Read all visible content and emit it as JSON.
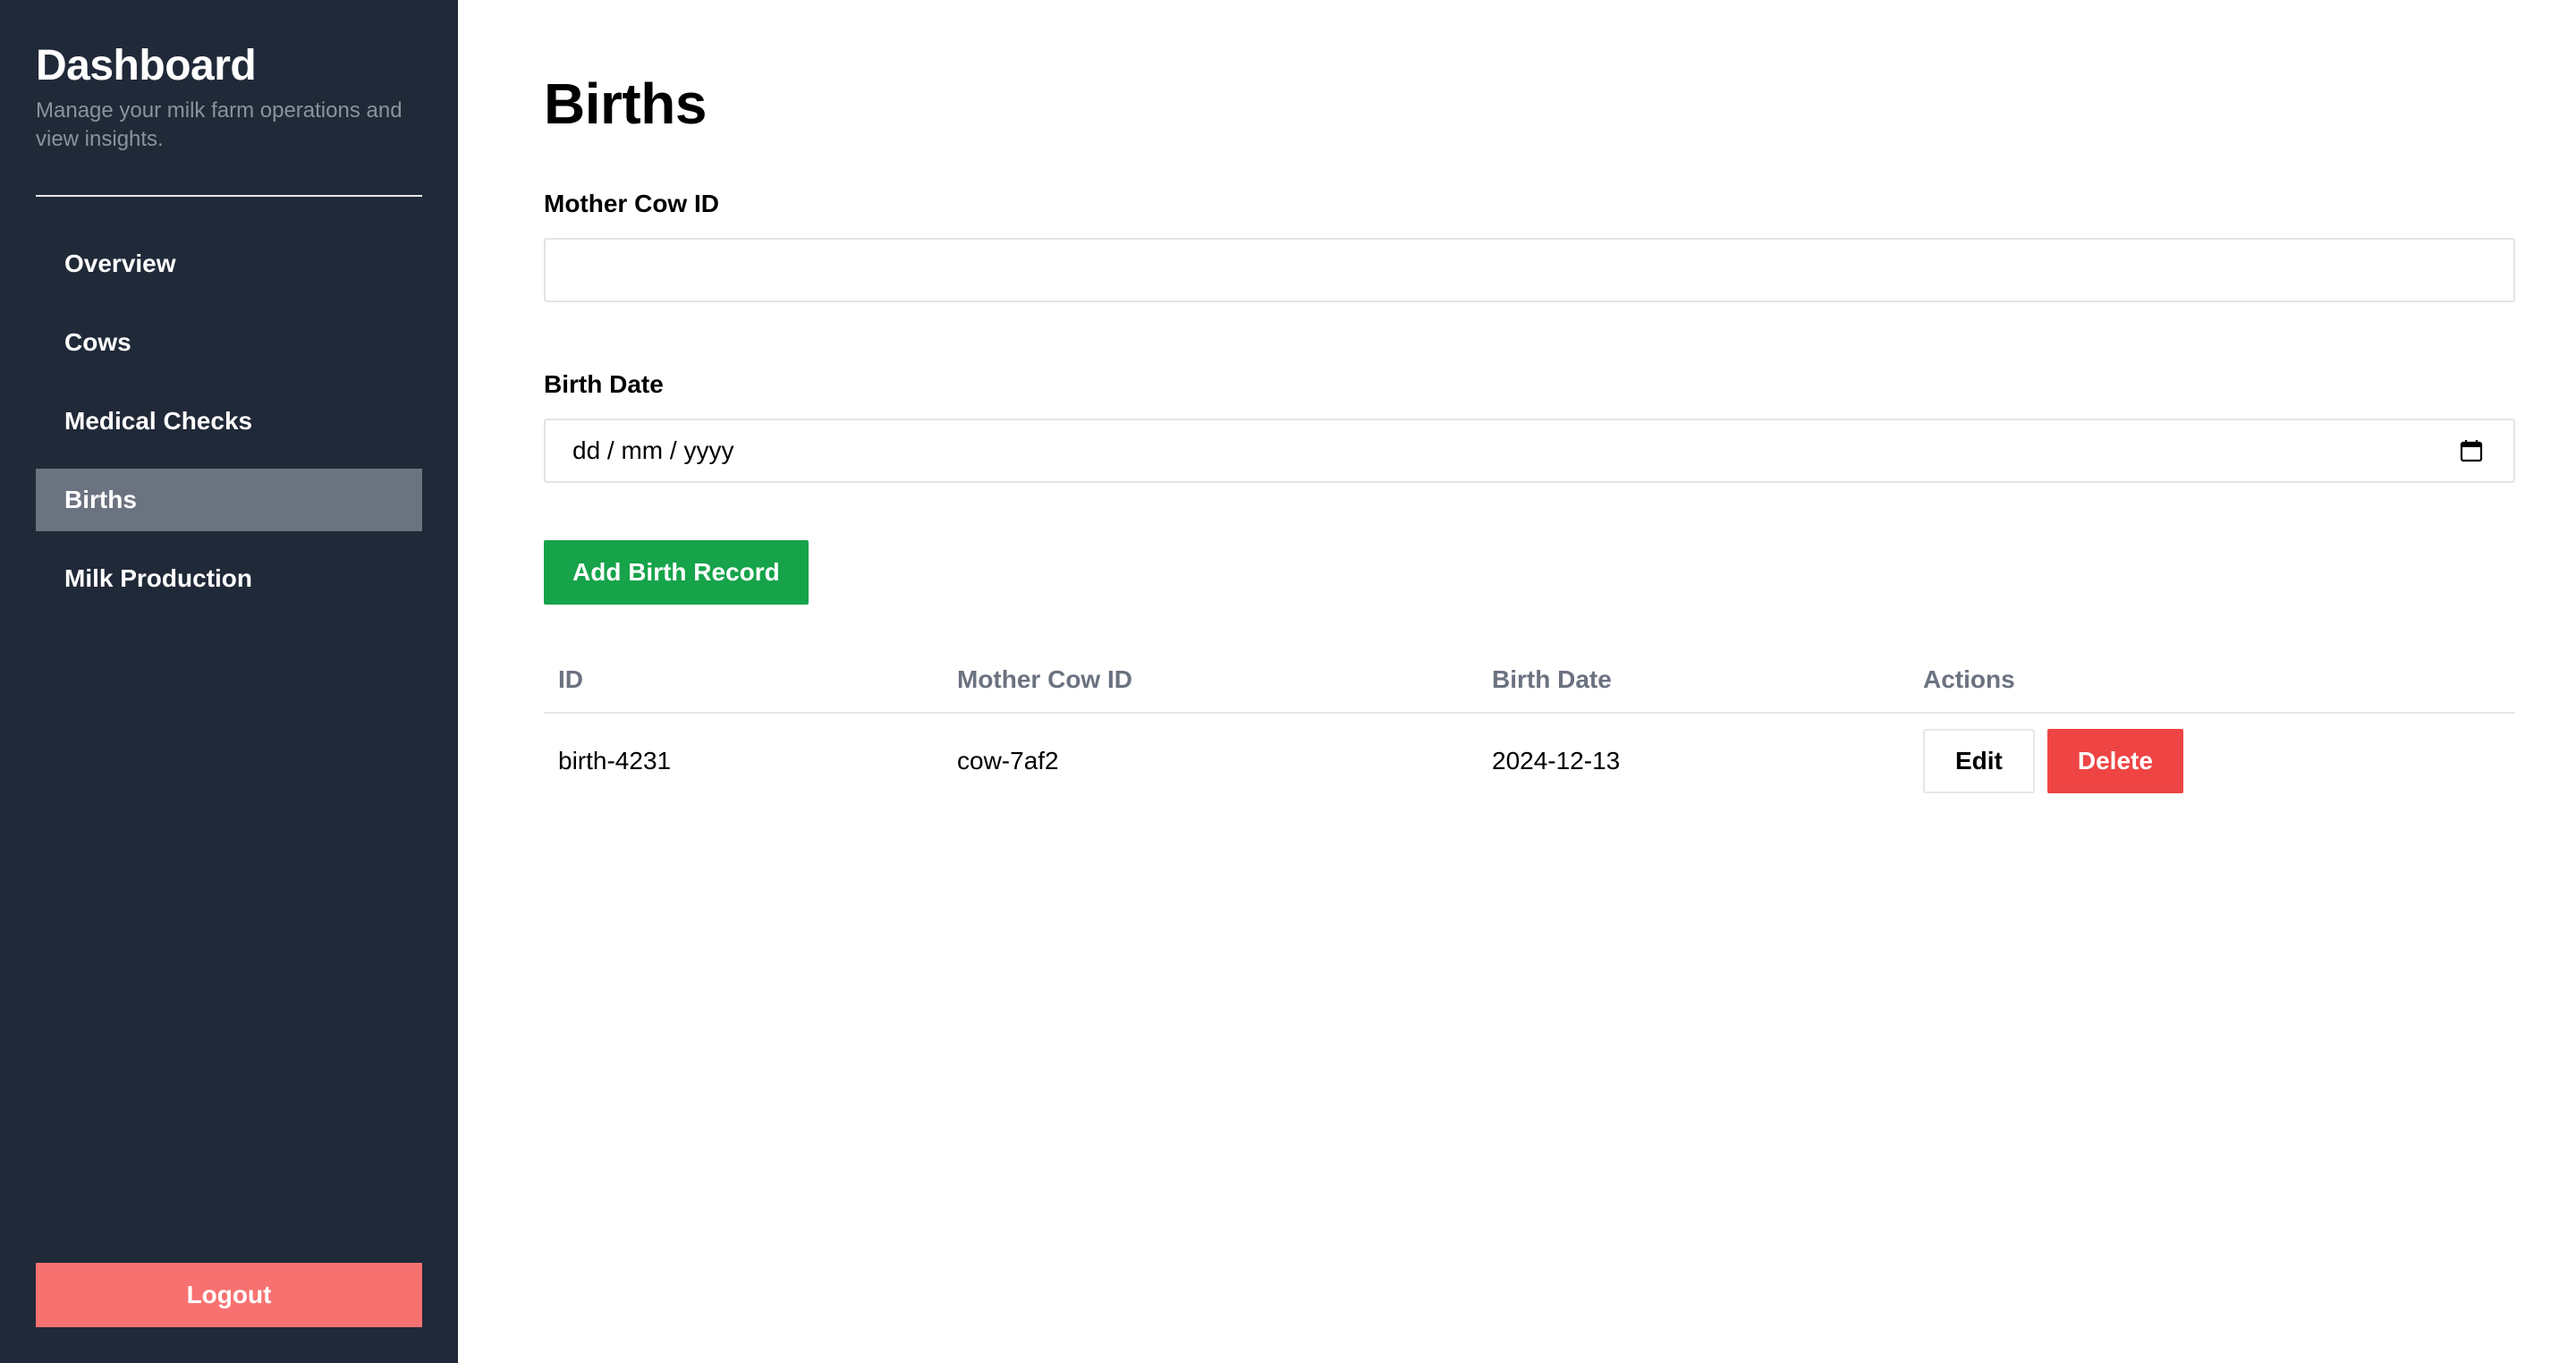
{
  "sidebar": {
    "title": "Dashboard",
    "subtitle": "Manage your milk farm operations and view insights.",
    "items": [
      {
        "label": "Overview",
        "active": false
      },
      {
        "label": "Cows",
        "active": false
      },
      {
        "label": "Medical Checks",
        "active": false
      },
      {
        "label": "Births",
        "active": true
      },
      {
        "label": "Milk Production",
        "active": false
      }
    ],
    "logout_label": "Logout"
  },
  "main": {
    "title": "Births",
    "form": {
      "mother_label": "Mother Cow ID",
      "mother_value": "",
      "date_label": "Birth Date",
      "date_placeholder": "dd / mm / yyyy",
      "date_icon": "calendar-icon",
      "submit_label": "Add Birth Record"
    },
    "table": {
      "headers": [
        "ID",
        "Mother Cow ID",
        "Birth Date",
        "Actions"
      ],
      "rows": [
        {
          "id": "birth-4231",
          "mother": "cow-7af2",
          "date": "2024-12-13",
          "edit_label": "Edit",
          "delete_label": "Delete"
        }
      ]
    }
  },
  "colors": {
    "sidebar_bg": "#202938",
    "active_item": "#6b7280",
    "logout": "#f87171",
    "add": "#16a34a",
    "delete": "#ef4444"
  }
}
